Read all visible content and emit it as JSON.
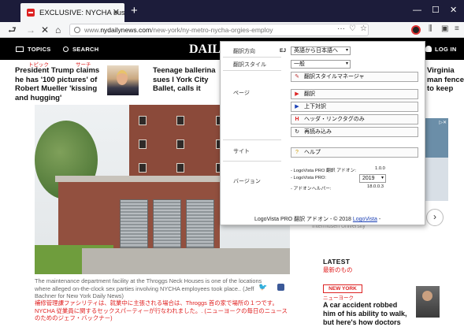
{
  "browser": {
    "tab_title": "EXCLUSIVE: NYCHA suspends t",
    "new_tab": "+",
    "url_prefix": "www.",
    "url_domain": "nydailynews.com",
    "url_path": "/new-york/ny-metro-nycha-orgies-employ",
    "url_more": "···"
  },
  "site": {
    "topics": "TOPICS",
    "search": "SEARCH",
    "logo": "DAIL",
    "login": "LOG IN"
  },
  "headlines": [
    {
      "text": "President Trump claims he has '100 pictures' of Robert Mueller 'kissing and hugging'"
    },
    {
      "text": "Teenage ballerina sues l York City Ballet, calls it perverted 'breeding gro"
    },
    {
      "text": "Virginia man fence to keep from his hou"
    }
  ],
  "annotations": {
    "president_jp": "トピック",
    "trump_jp": "サーチ"
  },
  "article": {
    "caption": "The maintenance department facility at the Throggs Neck Houses is one of the locations where alleged on-the-clock sex parties involving NYCHA employees took place.. (Jeff Bachner for New York Daily News)",
    "caption_jp": "補修管理課ファシリティは、就業中に主張される場合は、Throggs 首の家で場所の１つです。 NYCHA 従業員に関するセックスパーティーが行なわれました。. (ニューヨークの毎日のニュースのためのジェフ・バックナー)"
  },
  "sidebar": {
    "university": "Intermusen University",
    "latest": "LATEST",
    "latest_jp": "最新のもの",
    "badge": "NEW YORK",
    "badge_jp": "ニューヨーク",
    "story": "A car accident robbed him of his ability to walk, but here's how doctors got"
  },
  "logovista": {
    "label_direction": "翻訳方向",
    "label_style": "翻訳スタイル",
    "label_page": "ページ",
    "label_site": "サイト",
    "label_version": "バージョン",
    "ej": "EJ",
    "direction_value": "英語から日本語へ",
    "style_value": "一般",
    "style_manager": "翻訳スタイルマネージャ",
    "translate": "翻訳",
    "parallel": "上下対訳",
    "header_links": "ヘッダ・リンクタグのみ",
    "reload": "再読み込み",
    "help": "ヘルプ",
    "ver_addon_label": "- LogoVista PRO 翻訳 アドオン:",
    "ver_addon_value": "1.0.0",
    "ver_pro_label": "- LogoVista PRO:",
    "ver_pro_value": "2019",
    "ver_helper_label": "- アドオンヘルパー:",
    "ver_helper_value": "18.0.0.3",
    "footer_text": "LogoVista PRO 翻訳 アドオン - © 2018",
    "footer_link": "LogoVista",
    "footer_tail": "-"
  },
  "colors": {
    "tabbar": "#1c1c3a",
    "accent_red": "#e02020",
    "link_blue": "#1a3fb5"
  }
}
